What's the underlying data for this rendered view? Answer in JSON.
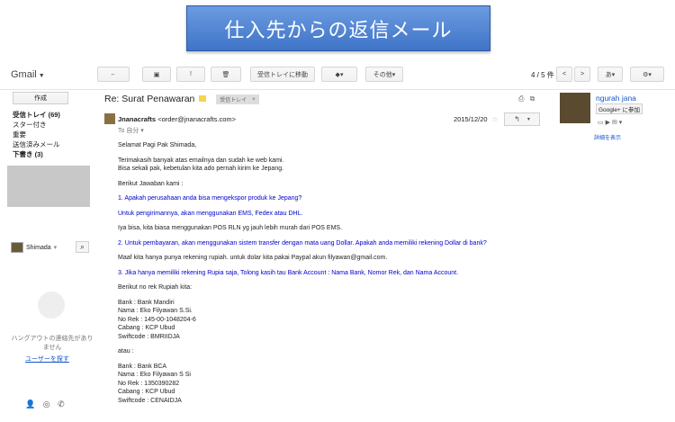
{
  "banner": {
    "title": "仕入先からの返信メール"
  },
  "topbar": {
    "app_label": "Gmail",
    "back_icon": "←",
    "archive_icon": "▣",
    "spam_icon": "!",
    "delete_icon": "🗑",
    "move_to_inbox": "受信トレイに移動",
    "labels_icon": "▾",
    "more": "その他",
    "pager": "4 / 5 件",
    "prev": "<",
    "next": ">",
    "lang": "あ",
    "settings_icon": "⚙"
  },
  "sidebar": {
    "compose": "作成",
    "items": [
      {
        "label": "受信トレイ (69)",
        "bold": true
      },
      {
        "label": "スター付き",
        "bold": false
      },
      {
        "label": "重要",
        "bold": false
      },
      {
        "label": "送信済みメール",
        "bold": false
      },
      {
        "label": "下書き (3)",
        "bold": true
      }
    ],
    "chat_user": "Shimada",
    "hangout_text": "ハングアウトの連絡先がありません",
    "hangout_link": "ユーザーを探す"
  },
  "message": {
    "subject": "Re: Surat Penawaran",
    "label": "受信トレイ",
    "label_close": "×",
    "sender_name": "Jnanacrafts",
    "sender_email": "<order@jnanacrafts.com>",
    "to": "To 自分",
    "date": "2015/12/20",
    "body": [
      {
        "text": "Selamat Pagi Pak Shimada,",
        "blue": false,
        "gap": false
      },
      {
        "text": "Terimakasih banyak atas emailnya dan sudah ke web kami.",
        "blue": false,
        "gap": true
      },
      {
        "text": "Bisa sekali pak, kebetulan kita ado pernah kirim ke Jepang.",
        "blue": false,
        "gap": false
      },
      {
        "text": "Berikut Jawaban kami :",
        "blue": false,
        "gap": true
      },
      {
        "text": "1. Apakah perusahaan anda bisa mengekspor produk ke Jepang?",
        "blue": true,
        "gap": true
      },
      {
        "text": "Untuk pengirimannya, akan menggunakan EMS, Fedex atau DHL.",
        "blue": true,
        "gap": true
      },
      {
        "text": "Iya bisa, kita biasa menggunakan POS RLN yg jauh lebih murah dari POS EMS.",
        "blue": false,
        "gap": true
      },
      {
        "text": "2. Untuk pembayaran, akan menggunakan sistem transfer dengan mata uang Dollar. Apakah anda memiliki rekening Dollar di bank?",
        "blue": true,
        "gap": true
      },
      {
        "text": "Maaf kita hanya punya rekening rupiah. untuk dolar kita pakai Paypal akun filyawan@gmail.com.",
        "blue": false,
        "gap": true
      },
      {
        "text": "3. Jika hanya memiliki rekening Rupia saja, Tolong kasih tau Bank Account : Nama Bank, Nomor Rek, dan Nama Account.",
        "blue": true,
        "gap": true
      },
      {
        "text": "Berikut no rek Rupiah kita:",
        "blue": false,
        "gap": true
      },
      {
        "text": "Bank : Bank Mandiri",
        "blue": false,
        "gap": true
      },
      {
        "text": "Nama : Eko Filyawan S.Si.",
        "blue": false,
        "gap": false
      },
      {
        "text": "No Rek : 145-00-1048204-6",
        "blue": false,
        "gap": false
      },
      {
        "text": "Cabang : KCP Ubud",
        "blue": false,
        "gap": false
      },
      {
        "text": "Swiftcode : BMRIIDJA",
        "blue": false,
        "gap": false
      },
      {
        "text": "atau :",
        "blue": false,
        "gap": true
      },
      {
        "text": "Bank : Bank BCA",
        "blue": false,
        "gap": true
      },
      {
        "text": "Nama : Eko Filyawan S Si",
        "blue": false,
        "gap": false
      },
      {
        "text": "No Rek : 1350390282",
        "blue": false,
        "gap": false
      },
      {
        "text": "Cabang : KCP Ubud",
        "blue": false,
        "gap": false
      },
      {
        "text": "Swiftcode : CENAIDJA",
        "blue": false,
        "gap": false
      }
    ]
  },
  "contact": {
    "name": "ngurah jana",
    "gplus": "Google+ に参加",
    "details": "詳細を表示"
  }
}
